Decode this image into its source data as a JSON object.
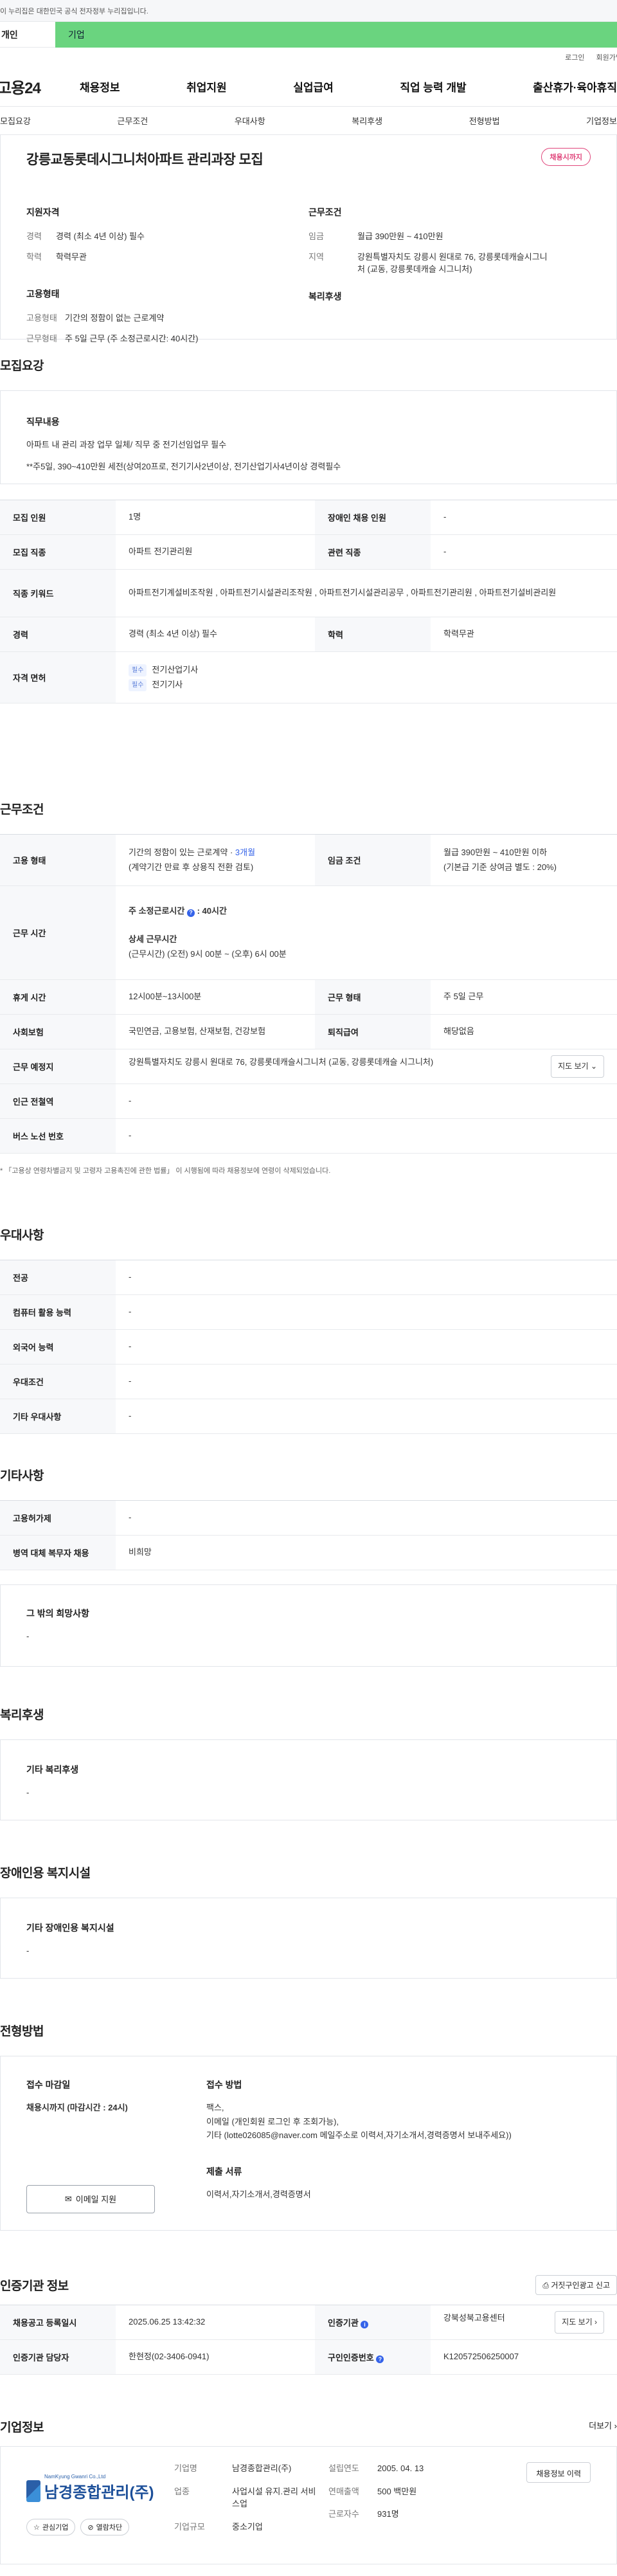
{
  "banner": {
    "text": "이 누리집은 대한민국 공식 전자정부 누리집입니다."
  },
  "site_tabs": {
    "left": "개인",
    "right": "기업"
  },
  "util": {
    "login": "로그인",
    "signup": "회원가입"
  },
  "gnb": {
    "logo": "고용24",
    "menu": [
      "채용정보",
      "취업지원",
      "실업급여",
      "직업 능력 개발",
      "출산휴가·육아휴직"
    ]
  },
  "sub_tabs": [
    "모집요강",
    "근무조건",
    "우대사항",
    "복리후생",
    "전형방법",
    "기업정보"
  ],
  "summary": {
    "title": "강릉교동롯데시그니처아파트 관리과장 모집",
    "status_badge": "채용시까지",
    "qual_title": "지원자격",
    "qual": [
      {
        "k": "경력",
        "v": "경력 (최소 4년 이상) 필수"
      },
      {
        "k": "학력",
        "v": "학력무관"
      }
    ],
    "work_title": "근무조건",
    "work": [
      {
        "k": "임금",
        "v": "월급 390만원 ~ 410만원"
      },
      {
        "k": "지역",
        "v": "강원특별자치도 강릉시 원대로 76, 강릉롯데캐슬시그니처 (교동, 강릉롯데캐슬 시그니처)"
      }
    ],
    "emp_title": "고용형태",
    "emp": [
      {
        "k": "고용형태",
        "v": "기간의 정함이 없는 근로계약"
      },
      {
        "k": "근무형태",
        "v": "주 5일 근무 (주 소정근로시간: 40시간)"
      }
    ],
    "welfare_title": "복리후생"
  },
  "recruit": {
    "section_title": "모집요강",
    "job_desc_title": "직무내용",
    "job_desc_1": "아파트 내 관리 과장 업무 일체/ 직무 중 전기선임업무 필수",
    "job_desc_2": "**주5일, 390~410만원 세전(상여20프로, 전기기사2년이상, 전기산업기사4년이상 경력필수",
    "rows": {
      "count_label": "모집 인원",
      "count": "1명",
      "disabled_label": "장애인 채용 인원",
      "disabled": "-",
      "job_label": "모집 직종",
      "job": "아파트 전기관리원",
      "related_label": "관련 직종",
      "related": "-",
      "keyword_label": "직종 키워드",
      "keywords": "아파트전기계설비조작원 , 아파트전기시설관리조작원 , 아파트전기시설관리공무 , 아파트전기관리원 , 아파트전기설비관리원",
      "career_label": "경력",
      "career": "경력 (최소 4년 이상) 필수",
      "edu_label": "학력",
      "edu": "학력무관",
      "license_label": "자격 면허",
      "req_tag": "필수",
      "license_1": "전기산업기사",
      "license_2": "전기기사"
    }
  },
  "conditions": {
    "section_title": "근무조건",
    "emp_type_label": "고용 형태",
    "emp_type": "기간의 정함이 있는 근로계약 · ",
    "emp_months": "3개월",
    "emp_type_sub": "(계약기간 만료 후 상용직 전환 검토)",
    "wage_label": "임금 조건",
    "wage": "월급 390만원 ~ 410만원 이하",
    "wage_sub": "(기본급 기준 상여금 별도 : 20%)",
    "hours_label": "근무 시간",
    "hours_week": "주 소정근로시간",
    "hours_week_value": ": 40시간",
    "hours_detail_title": "상세 근무시간",
    "hours_detail": "(근무시간) (오전) 9시 00분 ~ (오후) 6시 00분",
    "break_label": "휴게 시간",
    "break": "12시00분~13시00분",
    "work_type_label": "근무 형태",
    "work_type": "주 5일 근무",
    "insurance_label": "사회보험",
    "insurance": "국민연금, 고용보험, 산재보험, 건강보험",
    "severance_label": "퇴직급여",
    "severance": "해당없음",
    "location_label": "근무 예정지",
    "location": "강원특별자치도 강릉시 원대로 76, 강릉롯데캐슬시그니처 (교동, 강릉롯데캐슬 시그니처)",
    "map_btn": "지도 보기",
    "station_label": "인근 전철역",
    "station": "-",
    "bus_label": "버스 노선 번호",
    "bus": "-",
    "note": "* 「고용상 연령차별금지 및 고령자 고용촉진에 관한 법률」 이 시행됨에 따라 채용정보에 연령이 삭제되었습니다."
  },
  "preference": {
    "section_title": "우대사항",
    "rows": [
      {
        "k": "전공",
        "v": "-"
      },
      {
        "k": "컴퓨터 활용 능력",
        "v": "-"
      },
      {
        "k": "외국어 능력",
        "v": "-"
      },
      {
        "k": "우대조건",
        "v": "-"
      },
      {
        "k": "기타 우대사항",
        "v": "-"
      }
    ]
  },
  "etc": {
    "section_title": "기타사항",
    "rows": [
      {
        "k": "고용허가제",
        "v": "-"
      },
      {
        "k": "병역 대체 복무자 채용",
        "v": "비희망"
      }
    ],
    "other_title": "그 밖의 희망사항",
    "other_value": "-"
  },
  "welfare": {
    "section_title": "복리후생",
    "box_title": "기타 복리후생",
    "box_value": "-"
  },
  "facility": {
    "section_title": "장애인용 복지시설",
    "box_title": "기타 장애인용 복지시설",
    "box_value": "-"
  },
  "process": {
    "section_title": "전형방법",
    "deadline_title": "접수 마감일",
    "deadline": "채용시까지 (마감시간 : 24시)",
    "apply_btn": "이메일 지원",
    "method_title": "접수 방법",
    "method_1": "팩스,",
    "method_2": "이메일 (개인회원 로그인 후 조회가능),",
    "method_3": "기타 (lotte026085@naver.com 메일주소로 이력서,자기소개서,경력증명서 보내주세요))",
    "docs_title": "제출 서류",
    "docs": "이력서,자기소개서,경력증명서"
  },
  "agency": {
    "section_title": "인증기관 정보",
    "report_btn": "거짓구인광고 신고",
    "reg_label": "채용공고 등록일시",
    "reg": "2025.06.25 13:42:32",
    "agency_label": "인증기관",
    "agency": "강북성북고용센터",
    "map_btn": "지도 보기",
    "manager_label": "인증기관 담당자",
    "manager": "한현정(02-3406-0941)",
    "no_label": "구인인증번호",
    "no": "K120572506250007"
  },
  "company": {
    "section_title": "기업정보",
    "more": "더보기",
    "logo_top": "NamKyung Gwanri Co.,Ltd",
    "logo_name": "남경종합관리(주)",
    "fav_btn": "관심기업",
    "block_btn": "열람차단",
    "name_label": "기업명",
    "name": "남경종합관리(주)",
    "industry_label": "업종",
    "industry": "사업시설 유지.관리 서비스업",
    "scale_label": "기업규모",
    "scale": "중소기업",
    "founded_label": "설립연도",
    "founded": "2005. 04. 13",
    "sales_label": "연매출액",
    "sales": "500 백만원",
    "employees_label": "근로자수",
    "employees": "931명",
    "recruit_btn": "채용정보 이력"
  }
}
